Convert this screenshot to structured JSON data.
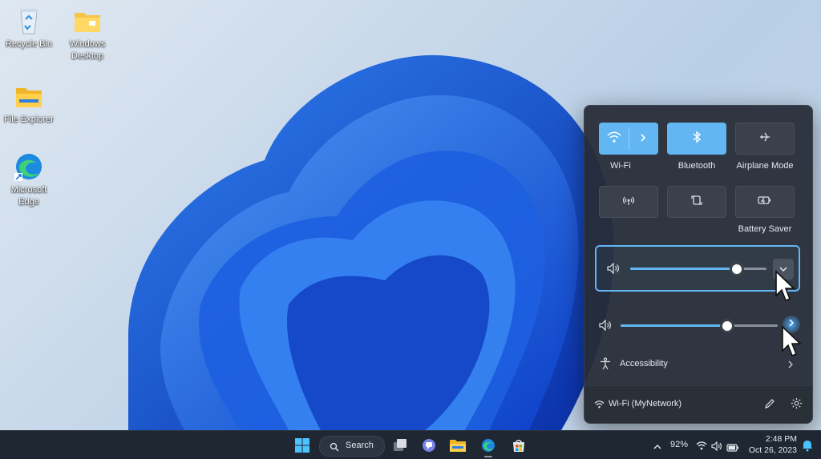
{
  "desktop": {
    "icons": [
      {
        "label": "Recycle Bin",
        "icon": "recycle-bin-icon"
      },
      {
        "label": "Windows Desktop",
        "icon": "folder-icon"
      },
      {
        "label": "File Explorer",
        "icon": "file-explorer-icon"
      },
      {
        "label": "Microsoft Edge",
        "icon": "edge-icon"
      }
    ]
  },
  "quick_settings": {
    "tiles": [
      {
        "label": "Wi-Fi",
        "state": "on",
        "icon": "wifi-icon"
      },
      {
        "label": "Bluetooth",
        "state": "on",
        "icon": "bluetooth-icon"
      },
      {
        "label": "Airplane Mode",
        "state": "off",
        "icon": "airplane-icon"
      },
      {
        "label": "",
        "state": "off",
        "icon": "mobile-hotspot-icon"
      },
      {
        "label": "",
        "state": "off",
        "icon": "rotation-lock-icon"
      },
      {
        "label": "Battery Saver",
        "state": "off",
        "icon": "battery-saver-icon"
      }
    ],
    "volume_primary": {
      "level": 0.78
    },
    "volume_secondary": {
      "level": 0.68
    },
    "accessibility_label": "Accessibility",
    "network_label": "Wi-Fi (MyNetwork)"
  },
  "taskbar": {
    "search_label": "Search",
    "battery": "92%",
    "time": "2:48 PM",
    "date": "Oct 26, 2023"
  },
  "colors": {
    "accent": "#62b7f3",
    "panel": "#262c36",
    "taskbar": "#1f2733"
  }
}
